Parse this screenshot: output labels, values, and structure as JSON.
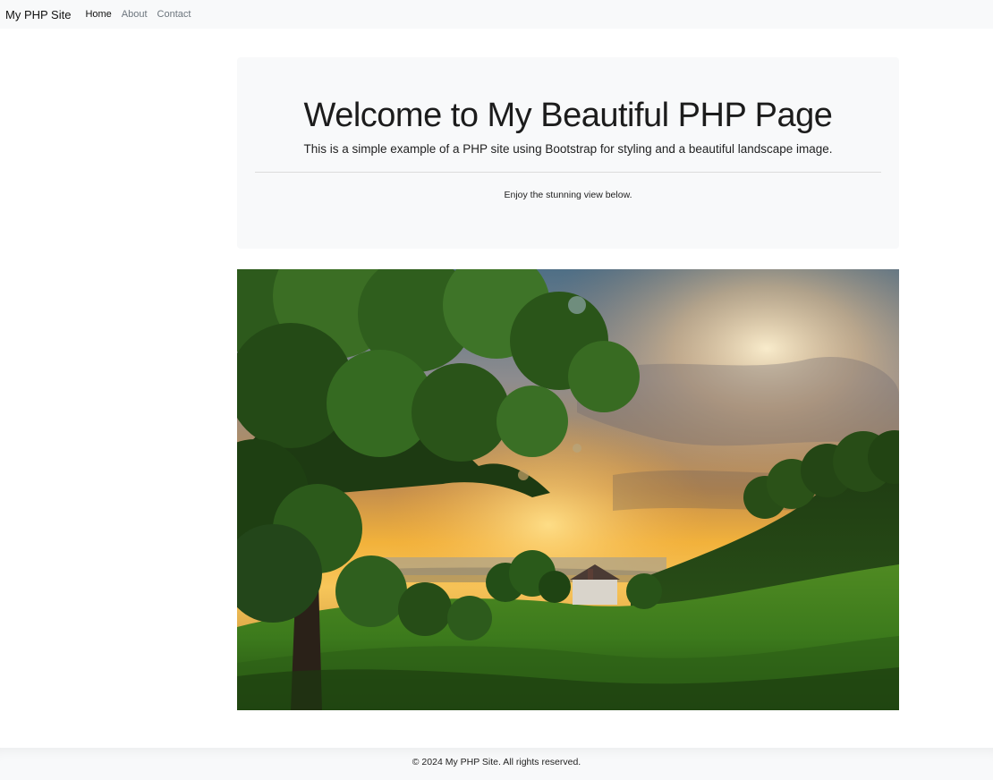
{
  "navbar": {
    "brand": "My PHP Site",
    "links": [
      "Home",
      "About",
      "Contact"
    ]
  },
  "hero": {
    "title": "Welcome to My Beautiful PHP Page",
    "lead": "This is a simple example of a PHP site using Bootstrap for styling and a beautiful landscape image.",
    "note": "Enjoy the stunning view below."
  },
  "image": {
    "description": "landscape photo"
  },
  "footer": {
    "text": "© 2024 My PHP Site. All rights reserved."
  }
}
